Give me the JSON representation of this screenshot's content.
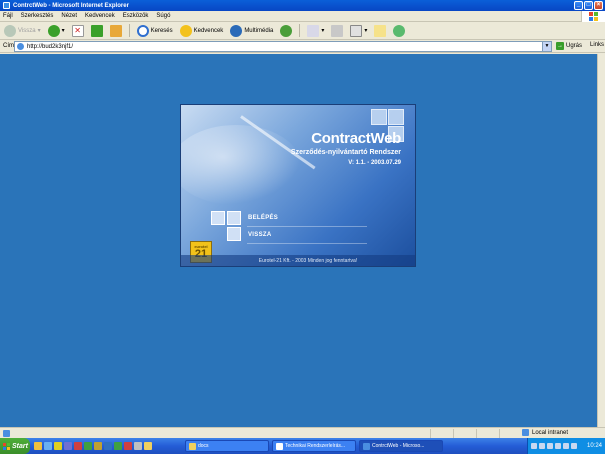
{
  "window": {
    "title": "ContrctWeb - Microsoft Internet Explorer"
  },
  "menubar": {
    "items": [
      "Fájl",
      "Szerkesztés",
      "Nézet",
      "Kedvencek",
      "Eszközök",
      "Súgó"
    ]
  },
  "toolbar": {
    "back_label": "Vissza",
    "search_label": "Keresés",
    "favorites_label": "Kedvencek",
    "media_label": "Multimédia"
  },
  "address": {
    "label": "Cím",
    "url": "http://bud2k3njf1/",
    "go_label": "Ugrás",
    "links_label": "Links"
  },
  "splash": {
    "brand": "ContractWeb",
    "subtitle": "Szerződés-nyilvántartó Rendszer",
    "version": "V: 1.1. - 2003.07.29",
    "menu": [
      "BELÉPÉS",
      "VISSZA"
    ],
    "logo_small": "eurotel",
    "logo_big": "21",
    "footer": "Eurotel-21 Kft. - 2003 Minden jog fenntartva!"
  },
  "statusbar": {
    "zone": "Local intranet"
  },
  "taskbar": {
    "start_label": "Start",
    "tasks": [
      "docs",
      "Technikai Rendszerleírás...",
      "ContrctWeb - Microso..."
    ],
    "clock": "10:24"
  },
  "colors": {
    "content_bg": "#2a74b9",
    "titlebar": "#0a5fd8",
    "taskbar": "#245dd6"
  }
}
